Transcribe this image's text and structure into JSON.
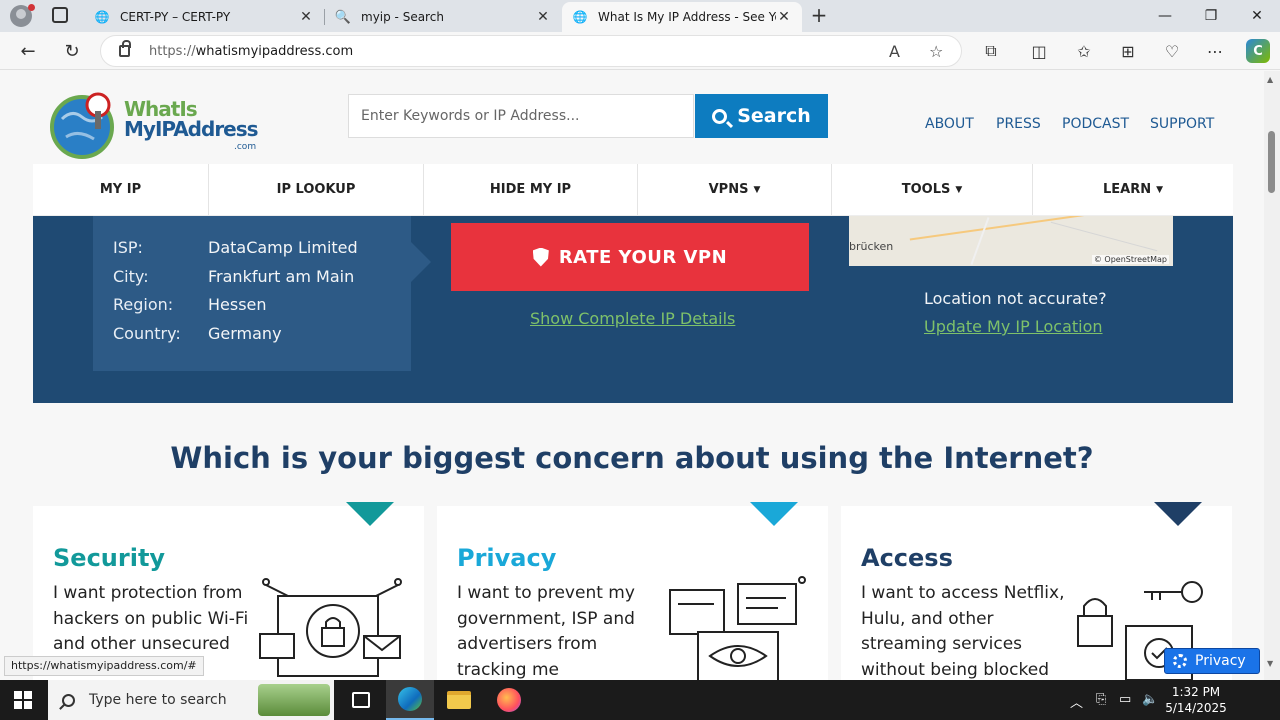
{
  "browser": {
    "tabs": [
      {
        "label": "CERT-PY – CERT-PY",
        "icon": "globe-icon"
      },
      {
        "label": "myip - Search",
        "icon": "search-icon"
      },
      {
        "label": "What Is My IP Address - See Your",
        "icon": "globe-icon"
      }
    ],
    "active_tab": 2,
    "url_scheme": "https://",
    "url_host": "whatismyipaddress.com"
  },
  "site": {
    "logo": {
      "line1": "WhatIs",
      "line2": "MyIPAddress",
      "line3": ".com"
    },
    "search": {
      "placeholder": "Enter Keywords or IP Address...",
      "button": "Search"
    },
    "top_links": [
      "ABOUT",
      "PRESS",
      "PODCAST",
      "SUPPORT"
    ],
    "nav": [
      {
        "label": "MY IP",
        "dropdown": false
      },
      {
        "label": "IP LOOKUP",
        "dropdown": false
      },
      {
        "label": "HIDE MY IP",
        "dropdown": false
      },
      {
        "label": "VPNS",
        "dropdown": true
      },
      {
        "label": "TOOLS",
        "dropdown": true
      },
      {
        "label": "LEARN",
        "dropdown": true
      }
    ],
    "info": [
      {
        "key": "ISP:",
        "value": "DataCamp Limited"
      },
      {
        "key": "City:",
        "value": "Frankfurt am Main"
      },
      {
        "key": "Region:",
        "value": "Hessen"
      },
      {
        "key": "Country:",
        "value": "Germany"
      }
    ],
    "rate_vpn": "RATE YOUR VPN",
    "show_details": "Show Complete IP Details",
    "map": {
      "place": "brücken",
      "attribution": "© OpenStreetMap"
    },
    "location_question": "Location not accurate?",
    "update_location": "Update My IP Location",
    "concern_heading": "Which is your biggest concern about using the Internet?",
    "cards": [
      {
        "title": "Security",
        "text": "I want protection from hackers on public Wi-Fi and other unsecured",
        "color": "#12999a"
      },
      {
        "title": "Privacy",
        "text": "I want to prevent my government, ISP and advertisers from tracking me",
        "color": "#1aa8d8"
      },
      {
        "title": "Access",
        "text": "I want to access Netflix, Hulu, and other streaming services without being blocked",
        "color": "#1f3f66"
      }
    ],
    "status_url": "https://whatismyipaddress.com/#",
    "privacy_badge": "Privacy"
  },
  "taskbar": {
    "search_placeholder": "Type here to search",
    "time": "1:32 PM",
    "date": "5/14/2025"
  }
}
